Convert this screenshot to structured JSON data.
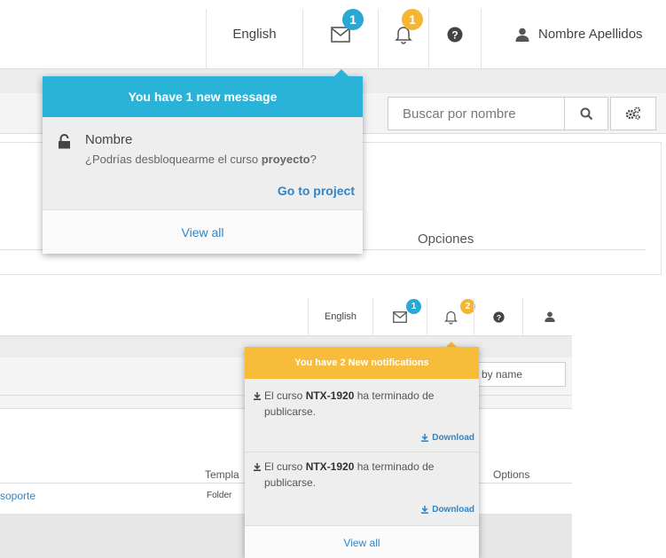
{
  "top": {
    "nav": {
      "language": "English",
      "messages_badge": "1",
      "notifications_badge": "1",
      "user_name": "Nombre Apellidos"
    },
    "search": {
      "placeholder": "Buscar por nombre"
    },
    "messages_popup": {
      "header": "You have 1 new message",
      "message": {
        "sender": "Nombre",
        "text_prefix": "¿Podrías desbloquearme el curso ",
        "text_bold": "proyecto",
        "text_suffix": "?",
        "action": "Go to project"
      },
      "view_all": "View all"
    },
    "table": {
      "column_options": "Opciones"
    }
  },
  "bottom": {
    "nav": {
      "language": "English",
      "messages_badge": "1",
      "notifications_badge": "2"
    },
    "search": {
      "placeholder_partial": "by name"
    },
    "notifications_popup": {
      "header": "You have 2 New notifications",
      "items": [
        {
          "prefix": "El curso ",
          "course": "NTX-1920",
          "suffix": " ha terminado de publicarse.",
          "action": "Download"
        },
        {
          "prefix": "El curso ",
          "course": "NTX-1920",
          "suffix": " ha terminado de publicarse.",
          "action": "Download"
        }
      ],
      "view_all": "View all"
    },
    "table": {
      "column_template_partial": "Templa",
      "column_options": "Options",
      "row_name_partial": "soporte",
      "row_type": "Folder"
    }
  },
  "colors": {
    "message_header": "#29b3d8",
    "notification_header": "#f6bc3a",
    "link": "#2e86c8"
  }
}
